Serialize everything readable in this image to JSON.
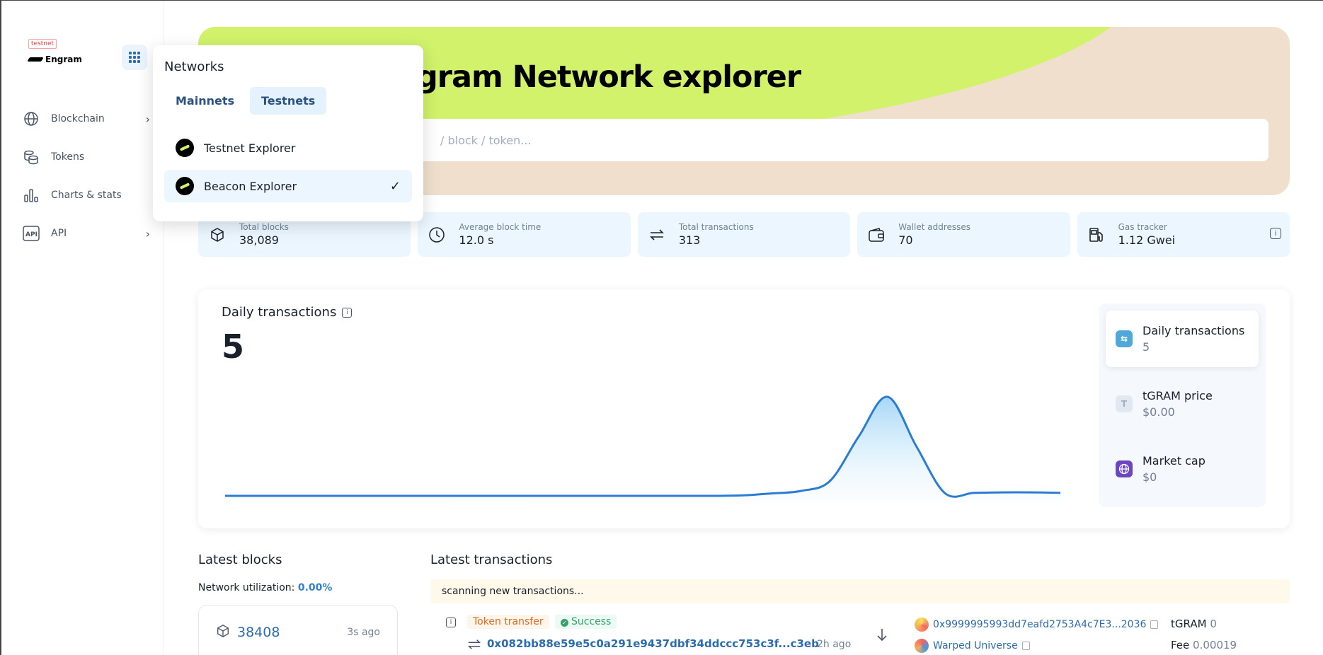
{
  "sidebar": {
    "badge": "testnet",
    "logo_text": "Engram",
    "items": [
      {
        "label": "Blockchain",
        "icon": "globe-icon",
        "has_chevron": true
      },
      {
        "label": "Tokens",
        "icon": "coins-icon",
        "has_chevron": false
      },
      {
        "label": "Charts & stats",
        "icon": "bar-chart-icon",
        "has_chevron": false
      },
      {
        "label": "API",
        "icon": "api-icon",
        "has_chevron": true
      }
    ],
    "chevron": "›"
  },
  "hero": {
    "title": "Engram Network explorer",
    "search_placeholder": "/ block / token..."
  },
  "stats": [
    {
      "label": "Total blocks",
      "value": "38,089",
      "icon": "cube-icon"
    },
    {
      "label": "Average block time",
      "value": "12.0 s",
      "icon": "clock-icon"
    },
    {
      "label": "Total transactions",
      "value": "313",
      "icon": "arrows-icon"
    },
    {
      "label": "Wallet addresses",
      "value": "70",
      "icon": "wallet-icon"
    },
    {
      "label": "Gas tracker",
      "value": "1.12 Gwei",
      "icon": "gas-pump-icon"
    }
  ],
  "chart_card": {
    "title": "Daily transactions",
    "value": "5",
    "side": [
      {
        "label": "Daily transactions",
        "value": "5",
        "icon_color": "#4fa8d8"
      },
      {
        "label": "tGRAM price",
        "value": "$0.00",
        "icon_letter": "T",
        "icon_color": "#e2e8f0"
      },
      {
        "label": "Market cap",
        "value": "$0",
        "icon_color": "#6b46c1"
      }
    ]
  },
  "chart_data": {
    "type": "area",
    "title": "Daily transactions",
    "x": [
      0,
      1,
      2,
      3,
      4,
      5,
      6,
      7,
      8,
      9,
      10,
      11,
      12,
      13,
      14,
      15,
      16,
      17,
      18,
      19,
      20,
      21,
      22,
      23,
      24,
      25,
      26,
      27,
      28,
      29
    ],
    "values": [
      0,
      0,
      0,
      0,
      0,
      0,
      0,
      0,
      0,
      0,
      0,
      0,
      0,
      0,
      0,
      0,
      0,
      0,
      0.1,
      0.5,
      1,
      3,
      12,
      20,
      10,
      0.5,
      0.6,
      0.7,
      0.7,
      0.6
    ],
    "ylim": [
      0,
      22
    ],
    "grid": false,
    "legend": false,
    "color": "#2b7cd3"
  },
  "latest_blocks": {
    "title": "Latest blocks",
    "util_label": "Network utilization:",
    "util_value": "0.00%",
    "block_number": "38408",
    "block_age": "3s ago"
  },
  "latest_transactions": {
    "title": "Latest transactions",
    "scanning": "scanning new transactions...",
    "row": {
      "type_tag": "Token transfer",
      "status": "Success",
      "hash": "0x082bb88e59e5c0a291e9437dbf34ddccc753c3f...c3eb",
      "age": "2h ago",
      "from": "0x9999995993dd7eafd2753A4c7E3...2036",
      "to": "Warped Universe",
      "value_label": "tGRAM",
      "value": "0",
      "fee_label": "Fee",
      "fee": "0.00019"
    }
  },
  "dropdown": {
    "title": "Networks",
    "tabs": [
      "Mainnets",
      "Testnets"
    ],
    "items": [
      "Testnet Explorer",
      "Beacon Explorer"
    ],
    "check": "✓"
  }
}
